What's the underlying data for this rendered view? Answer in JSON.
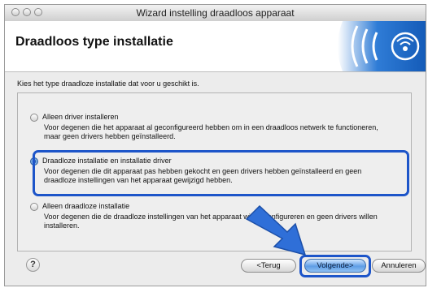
{
  "window": {
    "title": "Wizard instelling draadloos apparaat"
  },
  "header": {
    "title": "Draadloos type installatie"
  },
  "instruction": "Kies het type draadloze installatie dat voor u geschikt is.",
  "options": [
    {
      "label": "Alleen driver installeren",
      "description": "Voor degenen die het apparaat al geconfigureerd hebben om in een draadloos netwerk te functioneren, maar geen drivers hebben geïnstalleerd.",
      "selected": false
    },
    {
      "label": "Draadloze installatie en installatie driver",
      "description": "Voor degenen die dit apparaat pas hebben gekocht en geen drivers hebben geïnstalleerd en geen draadloze instellingen van het apparaat gewijzigd hebben.",
      "selected": true
    },
    {
      "label": "Alleen draadloze installatie",
      "description": "Voor degenen die de draadloze instellingen van het apparaat willen configureren en geen drivers willen installeren.",
      "selected": false
    }
  ],
  "buttons": {
    "help": "?",
    "back": "<Terug",
    "next": "Volgende>",
    "cancel": "Annuleren"
  },
  "colors": {
    "highlight": "#1d55c9",
    "arrow": "#2f6fd8",
    "banner": "#1b67c9"
  }
}
